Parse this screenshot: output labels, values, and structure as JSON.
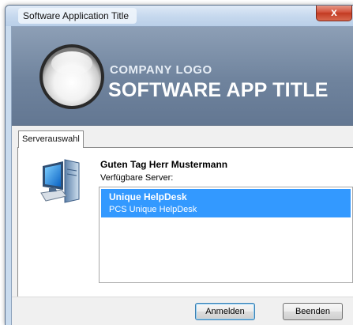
{
  "window": {
    "title": "Software Application Title",
    "close_label": "x"
  },
  "banner": {
    "company_logo": "COMPANY LOGO",
    "app_title": "SOFTWARE APP TITLE",
    "logo_icon": "glass-orb-icon"
  },
  "tabs": [
    {
      "label": "Serverauswahl",
      "selected": true
    }
  ],
  "panel": {
    "greeting": "Guten Tag Herr Mustermann",
    "server_label": "Verfügbare Server:",
    "servers": [
      {
        "name": "Unique HelpDesk",
        "description": "PCS Unique HelpDesk",
        "selected": true
      }
    ],
    "icon": "computer-icon"
  },
  "buttons": {
    "login": "Anmelden",
    "exit": "Beenden"
  },
  "colors": {
    "selection": "#3399ff",
    "banner": "#7489a3",
    "close_button": "#c9452d"
  }
}
